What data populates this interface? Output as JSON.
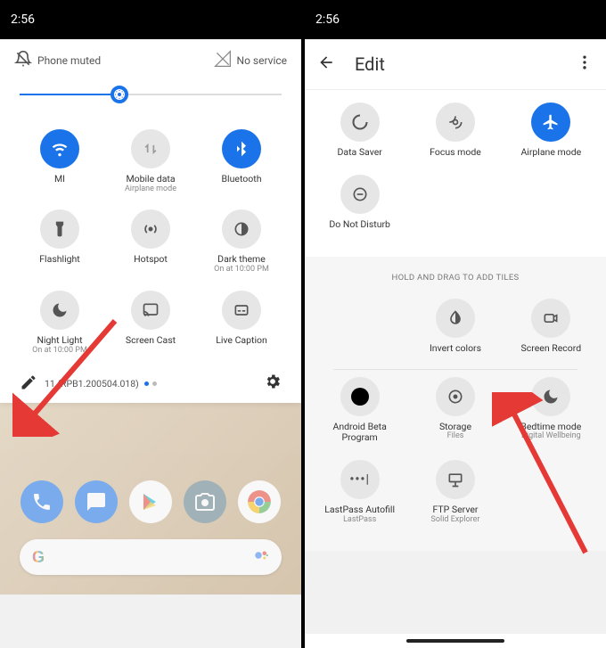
{
  "left": {
    "status": {
      "time": "2:56"
    },
    "qs_top": {
      "muted_label": "Phone muted",
      "signal_label": "No service"
    },
    "brightness_percent": 38,
    "tiles": [
      {
        "id": "wifi",
        "label": "MI",
        "sub": "",
        "on": true
      },
      {
        "id": "mobile-data",
        "label": "Mobile data",
        "sub": "Airplane mode",
        "on": false
      },
      {
        "id": "bluetooth",
        "label": "Bluetooth",
        "sub": "",
        "on": true
      },
      {
        "id": "flashlight",
        "label": "Flashlight",
        "sub": "",
        "on": false
      },
      {
        "id": "hotspot",
        "label": "Hotspot",
        "sub": "",
        "on": false
      },
      {
        "id": "dark-theme",
        "label": "Dark theme",
        "sub": "On at 10:00 PM",
        "on": false
      },
      {
        "id": "night-light",
        "label": "Night Light",
        "sub": "On at 10:00 PM",
        "on": false
      },
      {
        "id": "screen-cast",
        "label": "Screen Cast",
        "sub": "",
        "on": false
      },
      {
        "id": "live-caption",
        "label": "Live Caption",
        "sub": "",
        "on": false
      }
    ],
    "footer": {
      "build": "11 (RPB1.200504.018)"
    },
    "dock": [
      "phone",
      "messages",
      "play",
      "camera",
      "chrome"
    ],
    "search_initial": "G"
  },
  "right": {
    "status": {
      "time": "2:56"
    },
    "header": {
      "title": "Edit"
    },
    "active_tiles": [
      {
        "id": "data-saver",
        "label": "Data Saver",
        "sub": "",
        "on": false
      },
      {
        "id": "focus-mode",
        "label": "Focus mode",
        "sub": "",
        "on": false
      },
      {
        "id": "airplane-mode",
        "label": "Airplane mode",
        "sub": "",
        "on": true
      },
      {
        "id": "do-not-disturb",
        "label": "Do Not Disturb",
        "sub": "",
        "on": false
      }
    ],
    "drag_label": "HOLD AND DRAG TO ADD TILES",
    "available_tiles": [
      {
        "id": "invert-colors",
        "label": "Invert colors",
        "sub": ""
      },
      {
        "id": "screen-record",
        "label": "Screen Record",
        "sub": ""
      },
      {
        "id": "android-beta",
        "label": "Android Beta Program",
        "sub": ""
      },
      {
        "id": "storage",
        "label": "Storage",
        "sub": "Files"
      },
      {
        "id": "bedtime-mode",
        "label": "Bedtime mode",
        "sub": "Digital Wellbeing"
      },
      {
        "id": "lastpass",
        "label": "LastPass Autofill",
        "sub": "LastPass"
      },
      {
        "id": "ftp-server",
        "label": "FTP Server",
        "sub": "Solid Explorer"
      }
    ]
  }
}
